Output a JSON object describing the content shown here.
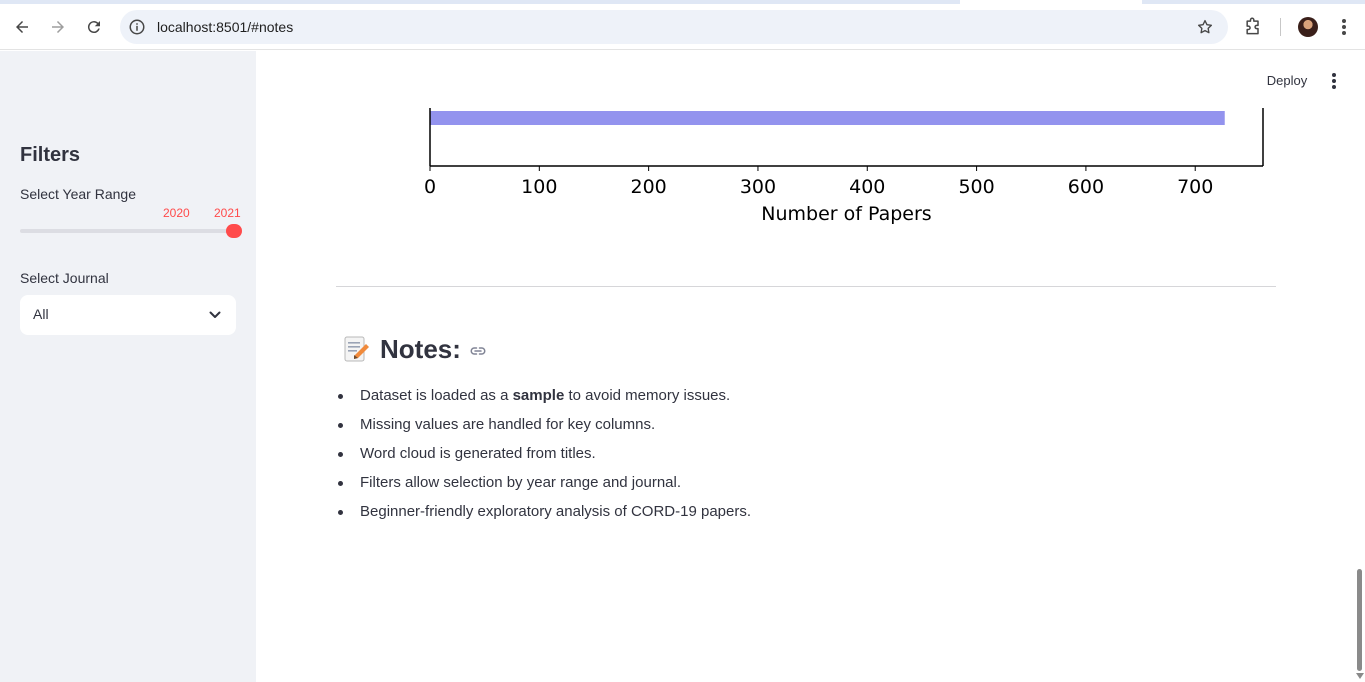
{
  "browser": {
    "url": "localhost:8501/#notes",
    "icons": [
      "back-arrow-icon",
      "forward-arrow-icon",
      "reload-icon",
      "site-info-icon",
      "bookmark-star-icon",
      "extensions-icon",
      "profile-avatar",
      "browser-menu-icon"
    ]
  },
  "sidebar": {
    "title": "Filters",
    "year_range": {
      "label": "Select Year Range",
      "min_value": "2020",
      "max_value": "2021"
    },
    "journal": {
      "label": "Select Journal",
      "selected": "All"
    }
  },
  "header": {
    "deploy_label": "Deploy"
  },
  "chart_data": {
    "type": "bar",
    "orientation": "horizontal",
    "values": [
      727
    ],
    "xlabel": "Number of Papers",
    "xticks": [
      "0",
      "100",
      "200",
      "300",
      "400",
      "500",
      "600",
      "700"
    ],
    "xlim": [
      0,
      762
    ],
    "bar_color": "#9393ee"
  },
  "notes": {
    "emoji": "memo-icon",
    "title": "Notes:",
    "items": [
      {
        "before": "Dataset is loaded as a ",
        "bold": "sample",
        "after": " to avoid memory issues."
      },
      {
        "before": "Missing values are handled for key columns.",
        "bold": "",
        "after": ""
      },
      {
        "before": "Word cloud is generated from titles.",
        "bold": "",
        "after": ""
      },
      {
        "before": "Filters allow selection by year range and journal.",
        "bold": "",
        "after": ""
      },
      {
        "before": "Beginner-friendly exploratory analysis of CORD-19 papers.",
        "bold": "",
        "after": ""
      }
    ]
  },
  "colors": {
    "accent": "#ff4b4b",
    "sidebar_bg": "#f0f2f6",
    "text": "#31333f"
  }
}
